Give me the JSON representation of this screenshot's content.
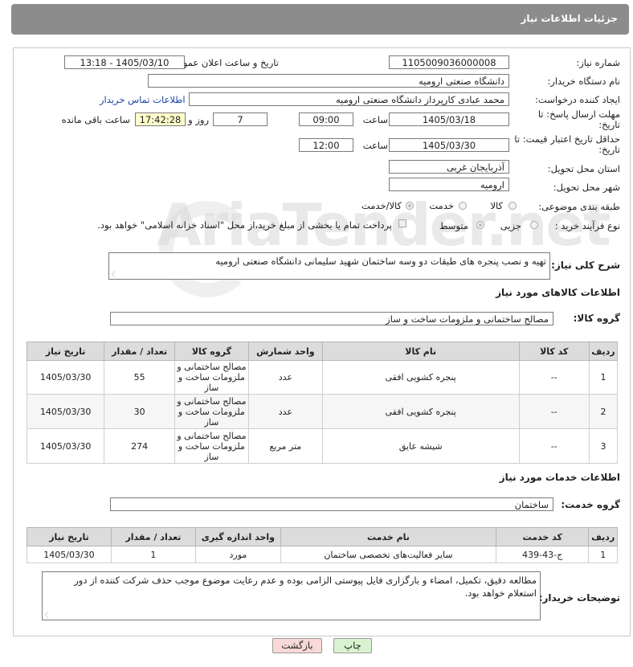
{
  "header": {
    "title": "جزئیات اطلاعات نیاز"
  },
  "watermark": "AriaTender.net",
  "form": {
    "need_number_label": "شماره نیاز:",
    "need_number": "1105009036000008",
    "announce_label": "تاریخ و ساعت اعلان عمومی:",
    "announce_value": "1405/03/10 - 13:18",
    "buyer_org_label": "نام دستگاه خریدار:",
    "buyer_org": "دانشگاه صنعتی ارومیه",
    "creator_label": "ایجاد کننده درخواست:",
    "creator": "محمد عبادی کارپرداز دانشگاه صنعتی ارومیه",
    "contact_link": "اطلاعات تماس خریدار",
    "send_deadline_label": "مهلت ارسال پاسخ: تا تاریخ:",
    "send_date": "1405/03/18",
    "time_word": "ساعت",
    "send_time": "09:00",
    "days": "7",
    "days_word": "روز و",
    "remaining_time": "17:42:28",
    "remaining_word": "ساعت باقی مانده",
    "price_validity_label": "حداقل تاریخ اعتبار قیمت: تا تاریخ:",
    "price_date": "1405/03/30",
    "price_time": "12:00",
    "province_label": "استان محل تحویل:",
    "province": "آذربایجان غربی",
    "city_label": "شهر محل تحویل:",
    "city": "ارومیه",
    "category_label": "طبقه بندی موضوعی:",
    "category_options": [
      "کالا",
      "خدمت",
      "کالا/خدمت"
    ],
    "process_label": "نوع فرآیند خرید :",
    "process_options": [
      "جزیی",
      "متوسط"
    ],
    "payment_note": "پرداخت تمام یا بخشی از مبلغ خرید،از محل \"اسناد خزانه اسلامی\" خواهد بود."
  },
  "description": {
    "label": "شرح کلی نیاز:",
    "text": "تهیه و نصب پنجره های طبقات دو وسه ساختمان شهید سلیمانی دانشگاه صنعتی ارومیه"
  },
  "goods": {
    "section_title": "اطلاعات کالاهای مورد نیاز",
    "group_label": "گروه کالا:",
    "group_value": "مصالح ساختمانی و ملزومات ساخت و ساز",
    "columns": [
      "ردیف",
      "کد کالا",
      "نام کالا",
      "واحد شمارش",
      "گروه کالا",
      "تعداد / مقدار",
      "تاریخ نیاز"
    ],
    "rows": [
      {
        "idx": "1",
        "code": "--",
        "name": "پنجره کشویی افقی",
        "unit": "عدد",
        "group": "مصالح ساختمانی و ملزومات ساخت و ساز",
        "qty": "55",
        "date": "1405/03/30"
      },
      {
        "idx": "2",
        "code": "--",
        "name": "پنجره کشویی افقی",
        "unit": "عدد",
        "group": "مصالح ساختمانی و ملزومات ساخت و ساز",
        "qty": "30",
        "date": "1405/03/30"
      },
      {
        "idx": "3",
        "code": "--",
        "name": "شیشه عایق",
        "unit": "متر مربع",
        "group": "مصالح ساختمانی و ملزومات ساخت و ساز",
        "qty": "274",
        "date": "1405/03/30"
      }
    ]
  },
  "services": {
    "section_title": "اطلاعات خدمات مورد نیاز",
    "group_label": "گروه خدمت:",
    "group_value": "ساختمان",
    "columns": [
      "ردیف",
      "کد خدمت",
      "نام خدمت",
      "واحد اندازه گیری",
      "تعداد / مقدار",
      "تاریخ نیاز"
    ],
    "rows": [
      {
        "idx": "1",
        "code": "ج-43-439",
        "name": "سایر فعالیت‌های تخصصی ساختمان",
        "unit": "مورد",
        "qty": "1",
        "date": "1405/03/30"
      }
    ]
  },
  "buyer_notes": {
    "label": "توضیحات خریدار:",
    "text": "مطالعه دقیق، تکمیل، امضاء و بارگزاری فایل پیوستی الزامی بوده و عدم رعایت موضوع موجب حذف شرکت کننده از دور استعلام خواهد بود."
  },
  "buttons": {
    "print": "چاپ",
    "back": "بازگشت"
  },
  "colors": {
    "header_bg": "#8c8c8c",
    "link": "#1a47a3",
    "highlight": "#ffffcc",
    "back_btn": "#f9d8d8",
    "print_btn": "#d9f3d0"
  }
}
